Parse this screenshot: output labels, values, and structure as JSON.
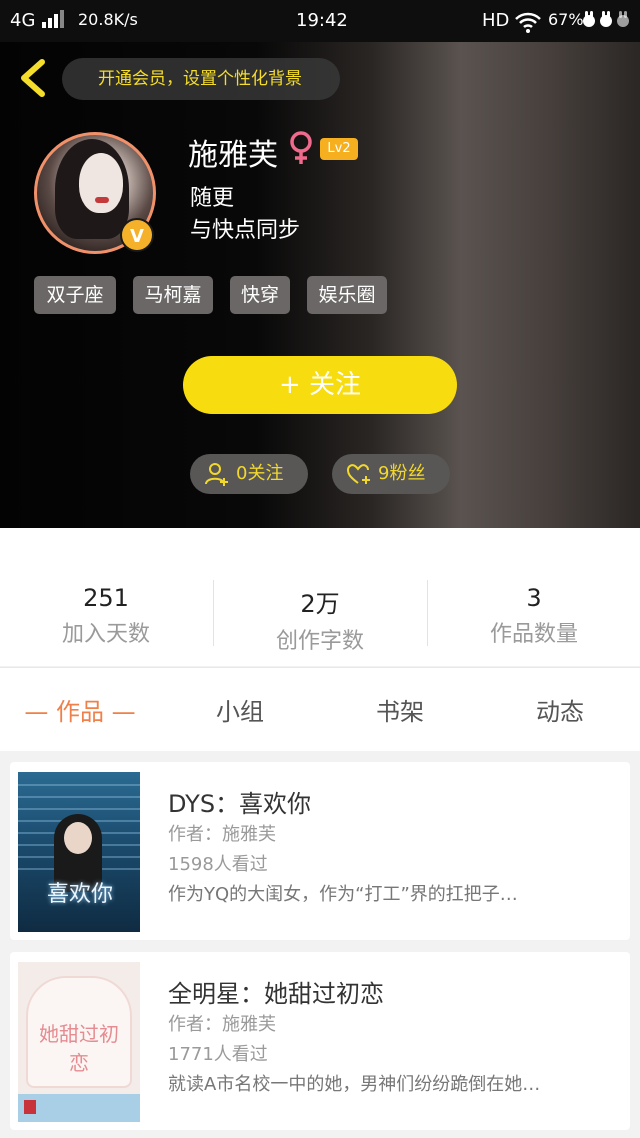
{
  "status_bar": {
    "network": "4G",
    "speed": "20.8K/s",
    "time": "19:42",
    "hd": "HD",
    "battery": "67%"
  },
  "header": {
    "vip_banner": "开通会员，设置个性化背景",
    "username": "施雅芙",
    "level": "Lv2",
    "avatar_badge": "V",
    "bio_line1": "随更",
    "bio_line2": "与快点同步",
    "tags": [
      "双子座",
      "马柯嘉",
      "快穿",
      "娱乐圈"
    ],
    "follow_button": "+ 关注",
    "following": "0关注",
    "fans": "9粉丝"
  },
  "stats": [
    {
      "value": "251",
      "label": "加入天数"
    },
    {
      "value": "2万",
      "label": "创作字数"
    },
    {
      "value": "3",
      "label": "作品数量"
    }
  ],
  "tabs": [
    {
      "label": "— 作品 —",
      "active": true
    },
    {
      "label": "小组",
      "active": false
    },
    {
      "label": "书架",
      "active": false
    },
    {
      "label": "动态",
      "active": false
    }
  ],
  "books": [
    {
      "title": "DYS：喜欢你",
      "author": "作者：施雅芙",
      "views": "1598人看过",
      "desc": "作为YQ的大闺女，作为“打工”界的扛把子…",
      "cover_text": "喜欢你"
    },
    {
      "title": "全明星：她甜过初恋",
      "author": "作者：施雅芙",
      "views": "1771人看过",
      "desc": "就读A市名校一中的她，男神们纷纷跪倒在她…",
      "cover_text": "她甜过初恋"
    }
  ],
  "colors": {
    "accent_orange": "#f0804a",
    "follow_yellow": "#f7dc0f",
    "banner_text_yellow": "#f5dd2b",
    "female_pink": "#f06a8c",
    "level_gold": "#f6b01f"
  }
}
